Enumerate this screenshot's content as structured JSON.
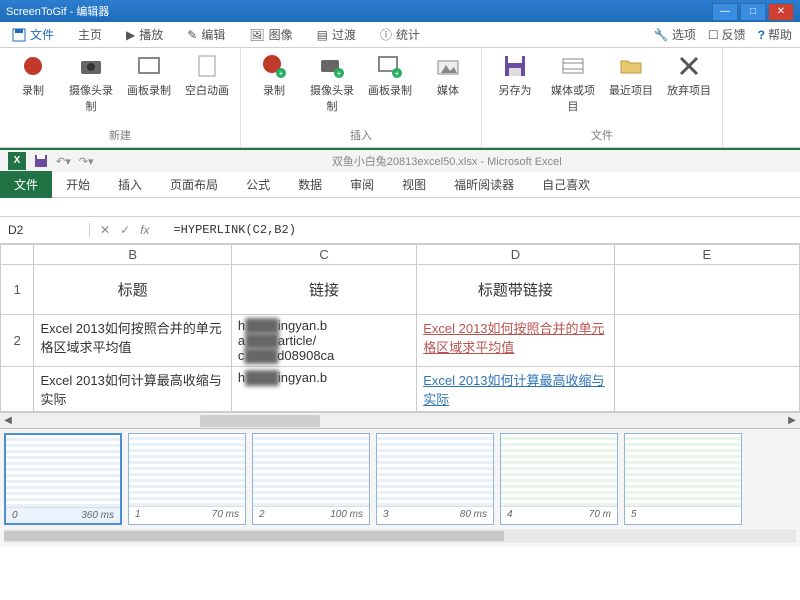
{
  "titlebar": {
    "app": "ScreenToGif",
    "sub": "编辑器"
  },
  "gif_tabs": {
    "file": "文件",
    "home": "主页",
    "play": "播放",
    "edit": "编辑",
    "image": "图像",
    "transition": "过渡",
    "stats": "统计",
    "options": "选项",
    "feedback": "反馈",
    "help": "帮助"
  },
  "ribbon": {
    "new": {
      "label": "新建",
      "items": {
        "record": "录制",
        "webcam": "摄像头录制",
        "board": "画板录制",
        "blank": "空白动画"
      }
    },
    "insert": {
      "label": "插入",
      "items": {
        "record": "录制",
        "webcam": "摄像头录制",
        "board": "画板录制",
        "media": "媒体"
      }
    },
    "file": {
      "label": "文件",
      "items": {
        "saveas": "另存为",
        "mediaproj": "媒体或项目",
        "recent": "最近项目",
        "discard": "放弃项目"
      }
    }
  },
  "excel": {
    "title": "双鱼小白兔20813excel50.xlsx - Microsoft Excel",
    "tabs": {
      "file": "文件",
      "home": "开始",
      "insert": "插入",
      "layout": "页面布局",
      "formula": "公式",
      "data": "数据",
      "review": "审阅",
      "view": "视图",
      "foxit": "福昕阅读器",
      "custom": "自己喜欢"
    },
    "namebox": "D2",
    "formula": "=HYPERLINK(C2,B2)",
    "cols": {
      "B": "B",
      "C": "C",
      "D": "D",
      "E": "E"
    },
    "rows": {
      "r1": "1",
      "r2": "2"
    },
    "headers": {
      "title": "标题",
      "link": "链接",
      "titlelink": "标题带链接"
    },
    "row2": {
      "B": "Excel 2013如何按照合并的单元格区域求平均值",
      "C1": "h",
      "C1b": "ingyan.b",
      "C2": "a",
      "C2b": "article/",
      "C3": "c",
      "C3b": "d08908ca",
      "D": "Excel 2013如何按照合并的单元格区域求平均值"
    },
    "row3": {
      "B": "Excel 2013如何计算最高收缩与实际",
      "C1": "h",
      "C1b": "ingyan.b",
      "D": "Excel 2013如何计算最高收缩与实际"
    }
  },
  "frames": [
    {
      "idx": "0",
      "ms": "360 ms",
      "sel": true,
      "green": false
    },
    {
      "idx": "1",
      "ms": "70 ms",
      "sel": false,
      "green": false
    },
    {
      "idx": "2",
      "ms": "100 ms",
      "sel": false,
      "green": false
    },
    {
      "idx": "3",
      "ms": "80 ms",
      "sel": false,
      "green": false
    },
    {
      "idx": "4",
      "ms": "70 m",
      "sel": false,
      "green": true
    },
    {
      "idx": "5",
      "ms": "",
      "sel": false,
      "green": true
    }
  ]
}
